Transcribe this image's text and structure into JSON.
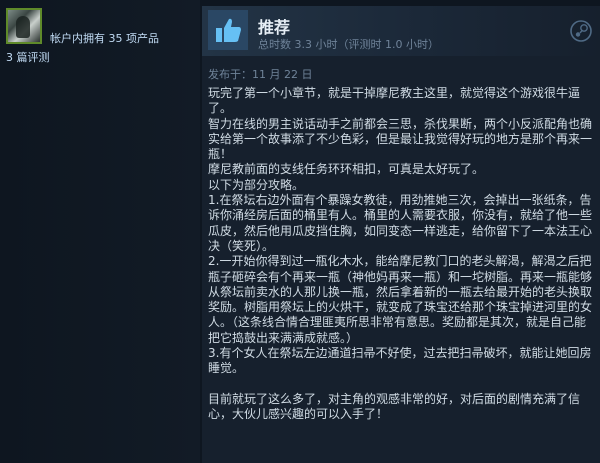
{
  "author": {
    "products_owned": "帐户内拥有 35 项产品",
    "reviews_count": "3 篇评测"
  },
  "review": {
    "recommendation": "推荐",
    "playtime": "总时数 3.3 小时（评测时 1.0 小时）",
    "posted_date": "发布于：11 月 22 日",
    "lines": [
      "玩完了第一个小章节，就是干掉摩尼教主这里，就觉得这个游戏很牛逼了。",
      "智力在线的男主说话动手之前都会三思，杀伐果断，两个小反派配角也确实给第一个故事添了不少色彩，但是最让我觉得好玩的地方是那个再来一瓶！",
      "摩尼教前面的支线任务环环相扣，可真是太好玩了。",
      "以下为部分攻略。",
      "1.在祭坛右边外面有个暴躁女教徒，用劲推她三次，会掉出一张纸条，告诉你涌经房后面的桶里有人。桶里的人需要衣服，你没有，就给了他一些瓜皮，然后他用瓜皮挡住胸，如同变态一样逃走，给你留下了一本法王心决（笑死）。",
      "2.一开始你得到过一瓶化木水，能给摩尼教门口的老头解渴，解渴之后把瓶子砸碎会有个再来一瓶（神他妈再来一瓶）和一坨树脂。再来一瓶能够从祭坛前卖水的人那儿换一瓶，然后拿着新的一瓶去给最开始的老头换取奖励。树脂用祭坛上的火烘干，就变成了珠宝还给那个珠宝掉进河里的女人。（这条线合情合理匪夷所思非常有意思。奖励都是其次，就是自己能把它捣鼓出来满满成就感。）",
      "3.有个女人在祭坛左边通道扫帚不好使，过去把扫帚破坏，就能让她回房睡觉。",
      "",
      "目前就玩了这么多了，对主角的观感非常的好，对后面的剧情充满了信心，大伙儿感兴趣的可以入手了！"
    ]
  },
  "colors": {
    "background": "#0e1620",
    "card": "#16202d",
    "header_gradient_start": "#233446",
    "accent_blue": "#66c0f4",
    "avatar_border": "#5f8a2a"
  },
  "icons": [
    "thumbs-up-icon",
    "steam-logo-icon",
    "avatar"
  ]
}
